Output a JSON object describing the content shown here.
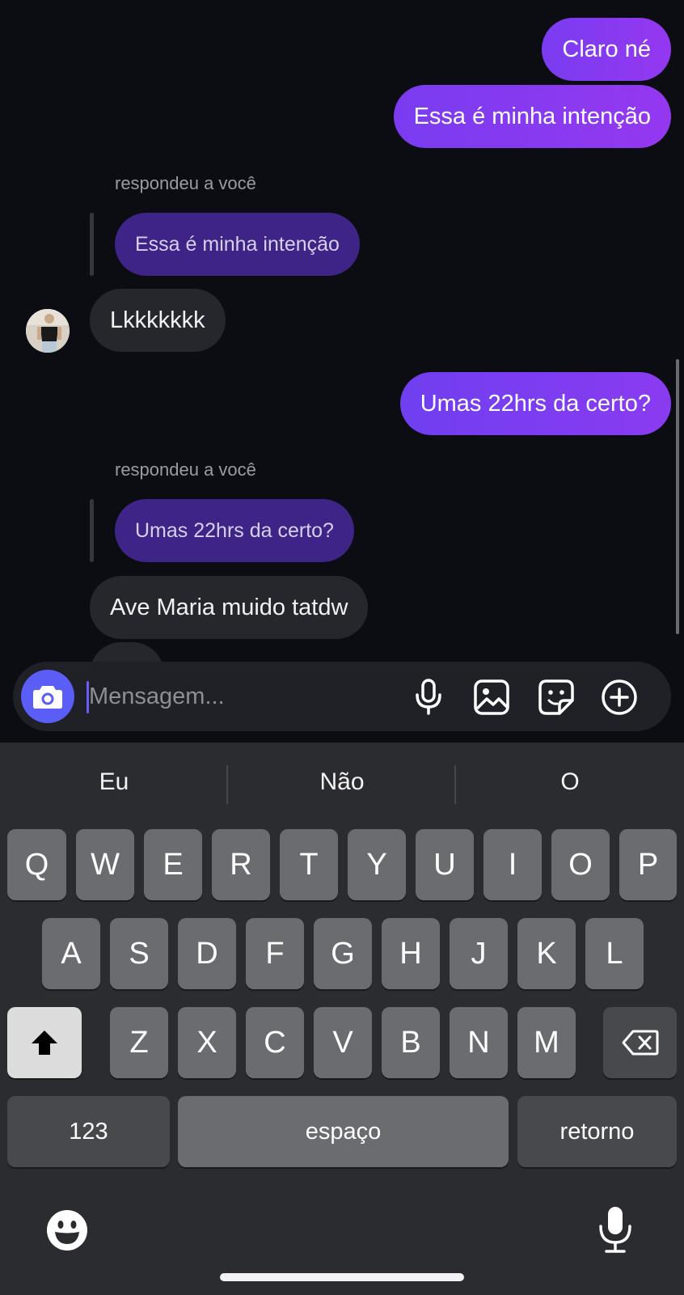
{
  "messages": {
    "out_1": "Claro né",
    "out_2": "Essa é minha intenção",
    "reply_label_1": "respondeu a você",
    "quoted_1": "Essa é minha intenção",
    "in_1": "Lkkkkkkk",
    "out_3": "Umas 22hrs da certo?",
    "reply_label_2": "respondeu a você",
    "quoted_2": "Umas 22hrs da certo?",
    "in_2": "Ave Maria muido tatdw"
  },
  "composer": {
    "placeholder": "Mensagem...",
    "camera_icon": "camera-icon",
    "tools": [
      "microphone-icon",
      "image-icon",
      "sticker-icon",
      "plus-circle-icon"
    ]
  },
  "keyboard": {
    "suggestions": [
      "Eu",
      "Não",
      "O"
    ],
    "row1": [
      "Q",
      "W",
      "E",
      "R",
      "T",
      "Y",
      "U",
      "I",
      "O",
      "P"
    ],
    "row2": [
      "A",
      "S",
      "D",
      "F",
      "G",
      "H",
      "J",
      "K",
      "L"
    ],
    "row3": [
      "Z",
      "X",
      "C",
      "V",
      "B",
      "N",
      "M"
    ],
    "numbers_label": "123",
    "space_label": "espaço",
    "return_label": "retorno"
  },
  "colors": {
    "accent": "#5b5ef6",
    "outgoing": "#8a3bf0",
    "incoming": "#25272c",
    "background": "#0b0d12"
  }
}
